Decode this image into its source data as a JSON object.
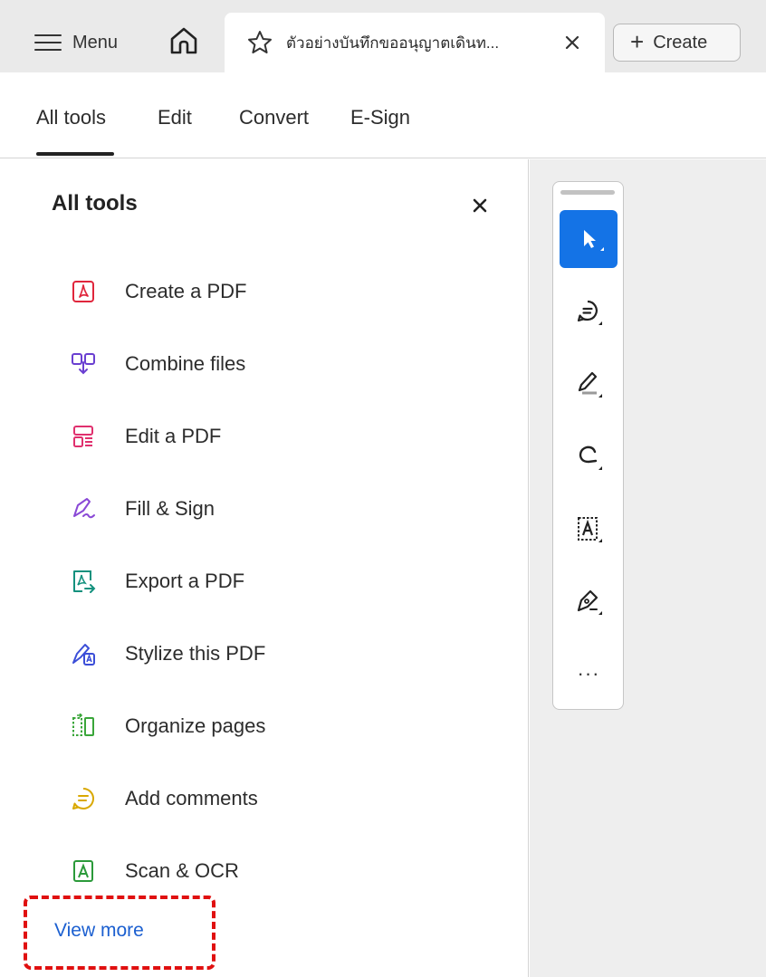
{
  "tabbar": {
    "menu_label": "Menu",
    "document_title": "ตัวอย่างบันทึกขออนุญาตเดินท...",
    "create_label": "Create",
    "plus_glyph": "+"
  },
  "subnav": {
    "items": [
      "All tools",
      "Edit",
      "Convert",
      "E-Sign"
    ],
    "active": "All tools"
  },
  "panel": {
    "title": "All tools",
    "close_glyph": "×",
    "tools": [
      {
        "label": "Create a PDF",
        "icon": "create-pdf-icon",
        "color": "#e0263c"
      },
      {
        "label": "Combine files",
        "icon": "combine-files-icon",
        "color": "#6a3fd1"
      },
      {
        "label": "Edit a PDF",
        "icon": "edit-pdf-icon",
        "color": "#e0306e"
      },
      {
        "label": "Fill & Sign",
        "icon": "fill-sign-icon",
        "color": "#8a49d6"
      },
      {
        "label": "Export a PDF",
        "icon": "export-pdf-icon",
        "color": "#14917e"
      },
      {
        "label": "Stylize this PDF",
        "icon": "stylize-pdf-icon",
        "color": "#3b4ed8"
      },
      {
        "label": "Organize pages",
        "icon": "organize-pages-icon",
        "color": "#3aa63a"
      },
      {
        "label": "Add comments",
        "icon": "add-comments-icon",
        "color": "#d9a800"
      },
      {
        "label": "Scan & OCR",
        "icon": "scan-ocr-icon",
        "color": "#2b9a3a"
      }
    ],
    "view_more_label": "View more"
  },
  "quick_tools": {
    "items": [
      "select-cursor-icon",
      "comment-icon",
      "highlight-icon",
      "draw-freeform-icon",
      "text-recognition-icon",
      "sign-pen-icon",
      "more-tools-icon"
    ],
    "active": "select-cursor-icon",
    "more_glyph": "···"
  },
  "colors": {
    "accent": "#1473e6",
    "link": "#1b5fd0",
    "highlight_box": "#e01010"
  }
}
